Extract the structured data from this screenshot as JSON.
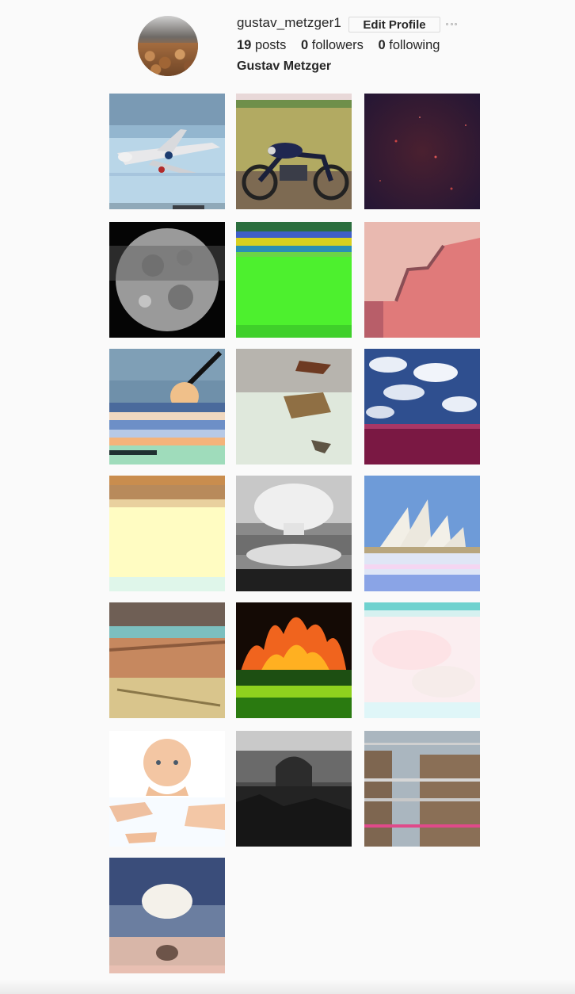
{
  "profile": {
    "username": "gustav_metzger1",
    "edit_label": "Edit Profile",
    "posts_count": "19",
    "posts_label": "posts",
    "followers_count": "0",
    "followers_label": "followers",
    "following_count": "0",
    "following_label": "following",
    "full_name": "Gustav Metzger"
  },
  "colors": {
    "background": "#fafafa",
    "text": "#262626",
    "border": "#dbdbdb"
  },
  "posts": [
    {
      "subject": "airplane-glitch"
    },
    {
      "subject": "motorcycle-field"
    },
    {
      "subject": "dark-starfield"
    },
    {
      "subject": "moon-glitch"
    },
    {
      "subject": "green-glitch"
    },
    {
      "subject": "pink-cracked-wall"
    },
    {
      "subject": "missile-launch-glitch"
    },
    {
      "subject": "debris-ground"
    },
    {
      "subject": "cloudy-sky-purple"
    },
    {
      "subject": "yellow-interior-glitch"
    },
    {
      "subject": "mushroom-cloud-bw"
    },
    {
      "subject": "sydney-opera-house"
    },
    {
      "subject": "rubble-pile"
    },
    {
      "subject": "burning-building"
    },
    {
      "subject": "pastel-glitch"
    },
    {
      "subject": "baby-doll"
    },
    {
      "subject": "hiroshima-dome"
    },
    {
      "subject": "ruined-stone-wall"
    },
    {
      "subject": "nuclear-cloud-sunset"
    }
  ]
}
